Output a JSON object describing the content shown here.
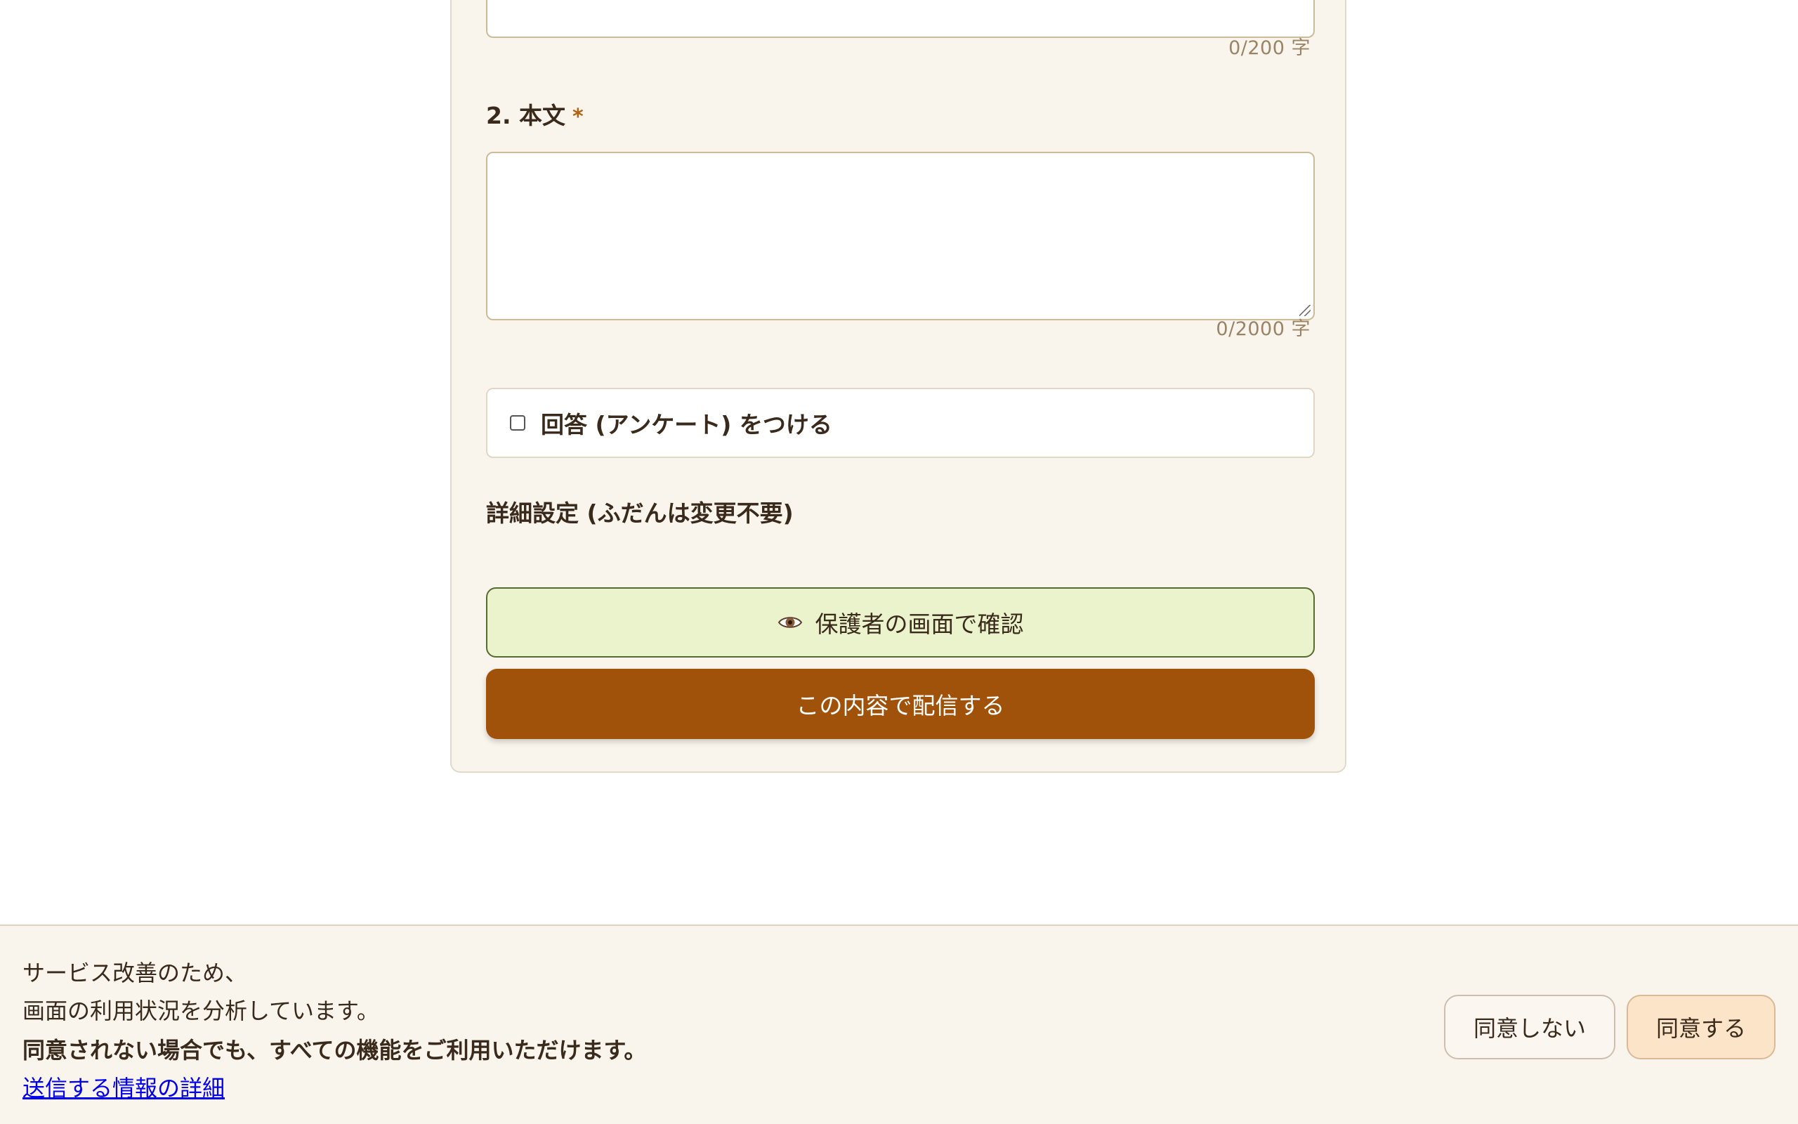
{
  "form": {
    "title_field": {
      "value": "",
      "counter": "0/200 字"
    },
    "body_field": {
      "label": "2. 本文",
      "required_mark": "*",
      "value": "",
      "counter": "0/2000 字"
    },
    "survey_option": {
      "checked": false,
      "label": "回答 (アンケート) をつける"
    },
    "advanced_settings_label": "詳細設定 (ふだんは変更不要)",
    "preview_button": {
      "icon": "eye-icon",
      "label": "保護者の画面で確認"
    },
    "send_button": {
      "label": "この内容で配信する"
    }
  },
  "consent_banner": {
    "line1": "サービス改善のため、",
    "line2": "画面の利用状況を分析しています。",
    "line3": "同意されない場合でも、すべての機能をご利用いただけます。",
    "details_link": "送信する情報の詳細",
    "decline_button": "同意しない",
    "accept_button": "同意する"
  },
  "colors": {
    "card_background": "#f9f4ec",
    "send_button": "#a0510a",
    "preview_button": "#eaf3cb",
    "accept_button": "#fce4c8",
    "required_mark": "#b36212"
  }
}
